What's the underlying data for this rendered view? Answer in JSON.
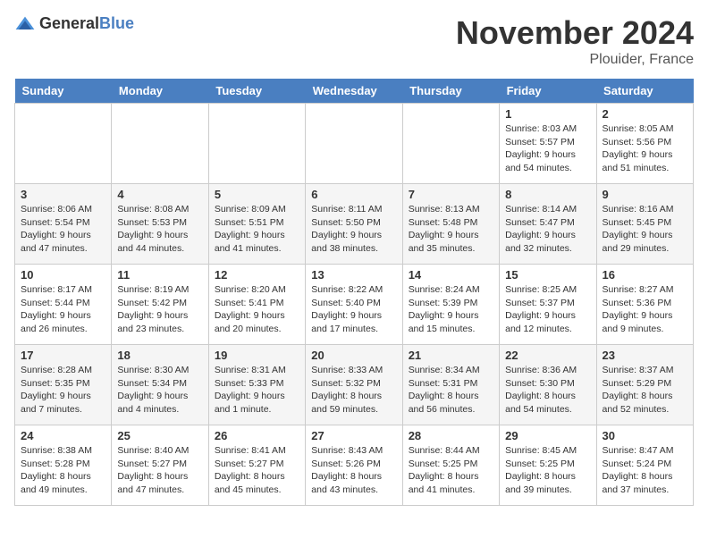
{
  "logo": {
    "text_general": "General",
    "text_blue": "Blue"
  },
  "header": {
    "month": "November 2024",
    "location": "Plouider, France"
  },
  "days_of_week": [
    "Sunday",
    "Monday",
    "Tuesday",
    "Wednesday",
    "Thursday",
    "Friday",
    "Saturday"
  ],
  "weeks": [
    [
      {
        "day": "",
        "info": ""
      },
      {
        "day": "",
        "info": ""
      },
      {
        "day": "",
        "info": ""
      },
      {
        "day": "",
        "info": ""
      },
      {
        "day": "",
        "info": ""
      },
      {
        "day": "1",
        "info": "Sunrise: 8:03 AM\nSunset: 5:57 PM\nDaylight: 9 hours and 54 minutes."
      },
      {
        "day": "2",
        "info": "Sunrise: 8:05 AM\nSunset: 5:56 PM\nDaylight: 9 hours and 51 minutes."
      }
    ],
    [
      {
        "day": "3",
        "info": "Sunrise: 8:06 AM\nSunset: 5:54 PM\nDaylight: 9 hours and 47 minutes."
      },
      {
        "day": "4",
        "info": "Sunrise: 8:08 AM\nSunset: 5:53 PM\nDaylight: 9 hours and 44 minutes."
      },
      {
        "day": "5",
        "info": "Sunrise: 8:09 AM\nSunset: 5:51 PM\nDaylight: 9 hours and 41 minutes."
      },
      {
        "day": "6",
        "info": "Sunrise: 8:11 AM\nSunset: 5:50 PM\nDaylight: 9 hours and 38 minutes."
      },
      {
        "day": "7",
        "info": "Sunrise: 8:13 AM\nSunset: 5:48 PM\nDaylight: 9 hours and 35 minutes."
      },
      {
        "day": "8",
        "info": "Sunrise: 8:14 AM\nSunset: 5:47 PM\nDaylight: 9 hours and 32 minutes."
      },
      {
        "day": "9",
        "info": "Sunrise: 8:16 AM\nSunset: 5:45 PM\nDaylight: 9 hours and 29 minutes."
      }
    ],
    [
      {
        "day": "10",
        "info": "Sunrise: 8:17 AM\nSunset: 5:44 PM\nDaylight: 9 hours and 26 minutes."
      },
      {
        "day": "11",
        "info": "Sunrise: 8:19 AM\nSunset: 5:42 PM\nDaylight: 9 hours and 23 minutes."
      },
      {
        "day": "12",
        "info": "Sunrise: 8:20 AM\nSunset: 5:41 PM\nDaylight: 9 hours and 20 minutes."
      },
      {
        "day": "13",
        "info": "Sunrise: 8:22 AM\nSunset: 5:40 PM\nDaylight: 9 hours and 17 minutes."
      },
      {
        "day": "14",
        "info": "Sunrise: 8:24 AM\nSunset: 5:39 PM\nDaylight: 9 hours and 15 minutes."
      },
      {
        "day": "15",
        "info": "Sunrise: 8:25 AM\nSunset: 5:37 PM\nDaylight: 9 hours and 12 minutes."
      },
      {
        "day": "16",
        "info": "Sunrise: 8:27 AM\nSunset: 5:36 PM\nDaylight: 9 hours and 9 minutes."
      }
    ],
    [
      {
        "day": "17",
        "info": "Sunrise: 8:28 AM\nSunset: 5:35 PM\nDaylight: 9 hours and 7 minutes."
      },
      {
        "day": "18",
        "info": "Sunrise: 8:30 AM\nSunset: 5:34 PM\nDaylight: 9 hours and 4 minutes."
      },
      {
        "day": "19",
        "info": "Sunrise: 8:31 AM\nSunset: 5:33 PM\nDaylight: 9 hours and 1 minute."
      },
      {
        "day": "20",
        "info": "Sunrise: 8:33 AM\nSunset: 5:32 PM\nDaylight: 8 hours and 59 minutes."
      },
      {
        "day": "21",
        "info": "Sunrise: 8:34 AM\nSunset: 5:31 PM\nDaylight: 8 hours and 56 minutes."
      },
      {
        "day": "22",
        "info": "Sunrise: 8:36 AM\nSunset: 5:30 PM\nDaylight: 8 hours and 54 minutes."
      },
      {
        "day": "23",
        "info": "Sunrise: 8:37 AM\nSunset: 5:29 PM\nDaylight: 8 hours and 52 minutes."
      }
    ],
    [
      {
        "day": "24",
        "info": "Sunrise: 8:38 AM\nSunset: 5:28 PM\nDaylight: 8 hours and 49 minutes."
      },
      {
        "day": "25",
        "info": "Sunrise: 8:40 AM\nSunset: 5:27 PM\nDaylight: 8 hours and 47 minutes."
      },
      {
        "day": "26",
        "info": "Sunrise: 8:41 AM\nSunset: 5:27 PM\nDaylight: 8 hours and 45 minutes."
      },
      {
        "day": "27",
        "info": "Sunrise: 8:43 AM\nSunset: 5:26 PM\nDaylight: 8 hours and 43 minutes."
      },
      {
        "day": "28",
        "info": "Sunrise: 8:44 AM\nSunset: 5:25 PM\nDaylight: 8 hours and 41 minutes."
      },
      {
        "day": "29",
        "info": "Sunrise: 8:45 AM\nSunset: 5:25 PM\nDaylight: 8 hours and 39 minutes."
      },
      {
        "day": "30",
        "info": "Sunrise: 8:47 AM\nSunset: 5:24 PM\nDaylight: 8 hours and 37 minutes."
      }
    ]
  ]
}
